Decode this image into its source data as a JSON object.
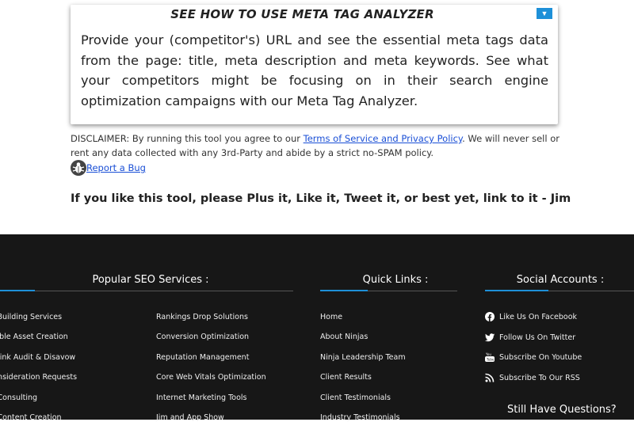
{
  "howto": {
    "title": "SEE HOW TO USE META TAG ANALYZER",
    "toggle_icon": "▼",
    "body": "Provide your (competitor's) URL and see the essential meta tags data from the page: title, meta description and meta keywords. See what your competitors might be focusing on in their search engine optimization campaigns with our Meta Tag Analyzer."
  },
  "disclaimer": {
    "prefix": "DISCLAIMER: By running this tool you agree to our ",
    "link": "Terms of Service and Privacy Policy",
    "suffix": ". We will never sell or rent any data collected with any 3rd-Party and abide by a strict no-SPAM policy."
  },
  "bug_link": "Report a Bug",
  "plea": "If you like this tool, please Plus it, Like it, Tweet it, or best yet, link to it - Jim",
  "footer": {
    "popular_heading": "Popular SEO Services :",
    "quick_heading": "Quick Links :",
    "social_heading": "Social Accounts :",
    "col1": [
      "Link Building Services",
      "Linkable Asset Creation",
      "Backlink Audit & Disavow",
      "Reconsideration Requests",
      "SEO Consulting",
      "SEO Content Creation"
    ],
    "col2": [
      "Rankings Drop Solutions",
      "Conversion Optimization",
      "Reputation Management",
      "Core Web Vitals Optimization",
      "Internet Marketing Tools",
      "Jim and App Show"
    ],
    "col3": [
      "Home",
      "About Ninjas",
      "Ninja Leadership Team",
      "Client Results",
      "Client Testimonials",
      "Industry Testimonials"
    ],
    "social": [
      "Like Us On Facebook",
      "Follow Us On Twitter",
      "Subscribe On Youtube",
      "Subscribe To Our RSS"
    ],
    "question": "Still Have Questions?"
  },
  "colors": {
    "accent": "#1e90d8",
    "footer_bg": "#171717",
    "link": "#1a4fd6"
  }
}
